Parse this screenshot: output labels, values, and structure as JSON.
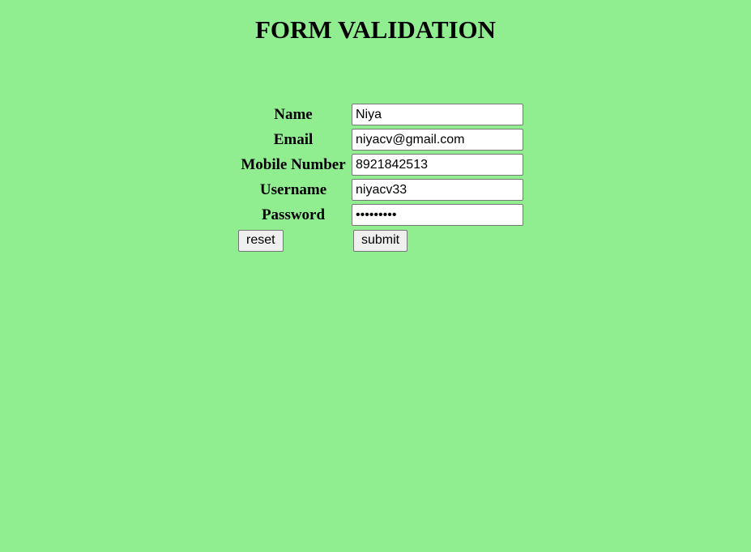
{
  "page": {
    "title": "FORM VALIDATION",
    "background_color": "#90ee90"
  },
  "form": {
    "fields": [
      {
        "label": "Name",
        "value": "Niya",
        "type": "text"
      },
      {
        "label": "Email",
        "value": "niyacv@gmail.com",
        "type": "text"
      },
      {
        "label": "Mobile Number",
        "value": "8921842513",
        "type": "text"
      },
      {
        "label": "Username",
        "value": "niyacv33",
        "type": "text"
      },
      {
        "label": "Password",
        "value": "•••••••••",
        "type": "password"
      }
    ],
    "reset_label": "reset",
    "submit_label": "submit"
  }
}
